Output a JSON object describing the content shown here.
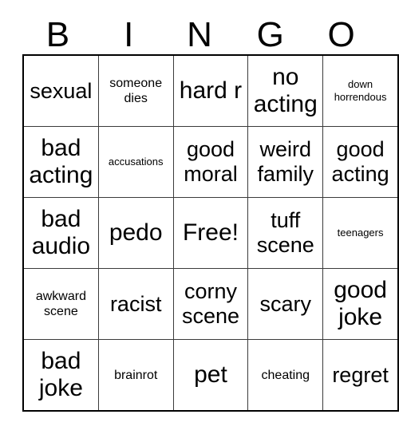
{
  "card": {
    "header_letters": [
      "B",
      "I",
      "N",
      "G",
      "O"
    ],
    "free_space_label": "Free!",
    "rows": [
      [
        {
          "text": "sexual",
          "size": "lg"
        },
        {
          "text": "someone dies",
          "size": "sm"
        },
        {
          "text": "hard r",
          "size": "xl"
        },
        {
          "text": "no acting",
          "size": "xl"
        },
        {
          "text": "down horrendous",
          "size": "xs"
        }
      ],
      [
        {
          "text": "bad acting",
          "size": "xl"
        },
        {
          "text": "accusations",
          "size": "xs"
        },
        {
          "text": "good moral",
          "size": "lg"
        },
        {
          "text": "weird family",
          "size": "lg"
        },
        {
          "text": "good acting",
          "size": "lg"
        }
      ],
      [
        {
          "text": "bad audio",
          "size": "xl"
        },
        {
          "text": "pedo",
          "size": "xl"
        },
        {
          "text": "Free!",
          "size": "xl"
        },
        {
          "text": "tuff scene",
          "size": "lg"
        },
        {
          "text": "teenagers",
          "size": "xs"
        }
      ],
      [
        {
          "text": "awkward scene",
          "size": "sm"
        },
        {
          "text": "racist",
          "size": "lg"
        },
        {
          "text": "corny scene",
          "size": "lg"
        },
        {
          "text": "scary",
          "size": "lg"
        },
        {
          "text": "good joke",
          "size": "xl"
        }
      ],
      [
        {
          "text": "bad joke",
          "size": "xl"
        },
        {
          "text": "brainrot",
          "size": "sm"
        },
        {
          "text": "pet",
          "size": "xl"
        },
        {
          "text": "cheating",
          "size": "sm"
        },
        {
          "text": "regret",
          "size": "lg"
        }
      ]
    ]
  },
  "colors": {
    "background": "#ffffff",
    "text": "#000000",
    "grid_line": "#3b3b3b",
    "outer_border": "#000000"
  }
}
